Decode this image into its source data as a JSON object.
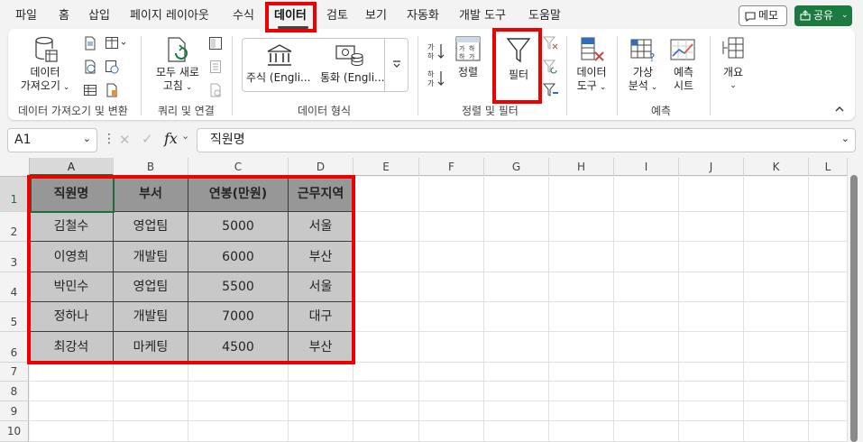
{
  "menu": {
    "items": [
      "파일",
      "홈",
      "삽입",
      "페이지 레이아웃",
      "수식",
      "데이터",
      "검토",
      "보기",
      "자동화",
      "개발 도구",
      "도움말"
    ],
    "memo": "메모",
    "share": "공유"
  },
  "ribbon": {
    "get_data": [
      "데이터",
      "가져오기"
    ],
    "refresh_all": [
      "모두 새로",
      "고침"
    ],
    "stock": "주식 (Engli...",
    "currency": "통화 (Engli...",
    "sort": "정렬",
    "filter": "필터",
    "data_tools": [
      "데이터",
      "도구"
    ],
    "what_if": [
      "가상",
      "분석"
    ],
    "forecast": [
      "예측",
      "시트"
    ],
    "outline": "개요",
    "groups": [
      "데이터 가져오기 및 변환",
      "쿼리 및 연결",
      "데이터 형식",
      "정렬 및 필터",
      "예측"
    ]
  },
  "formula_bar": {
    "name_box": "A1",
    "fx": "fx",
    "value": "직원명"
  },
  "sheet": {
    "columns": [
      "A",
      "B",
      "C",
      "D",
      "E",
      "F",
      "G",
      "H",
      "I",
      "J",
      "K",
      "L"
    ],
    "rows": [
      "1",
      "2",
      "3",
      "4",
      "5",
      "6",
      "7",
      "8",
      "9",
      "10"
    ],
    "table": {
      "headers": [
        "직원명",
        "부서",
        "연봉(만원)",
        "근무지역"
      ],
      "rows": [
        [
          "김철수",
          "영업팀",
          "5000",
          "서울"
        ],
        [
          "이영희",
          "개발팀",
          "6000",
          "부산"
        ],
        [
          "박민수",
          "영업팀",
          "5500",
          "서울"
        ],
        [
          "정하나",
          "개발팀",
          "7000",
          "대구"
        ],
        [
          "최강석",
          "마케팅",
          "4500",
          "부산"
        ]
      ]
    }
  },
  "colors": {
    "highlight": "#ee0000",
    "header_fill": "#979797",
    "cell_fill": "#c8c8c8",
    "share_button": "#1a7a3f"
  }
}
